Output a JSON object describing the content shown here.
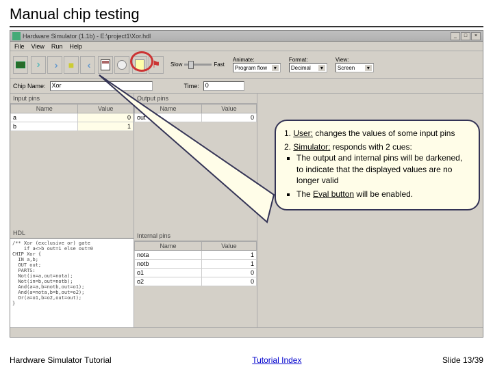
{
  "slide": {
    "title": "Manual chip testing"
  },
  "titlebar": {
    "text": "Hardware Simulator (1.1b) - E:\\project1\\Xor.hdl"
  },
  "menu": {
    "file": "File",
    "view": "View",
    "run": "Run",
    "help": "Help"
  },
  "toolbar": {
    "slow": "Slow",
    "fast": "Fast",
    "animate_lbl": "Animate:",
    "animate_val": "Program flow",
    "format_lbl": "Format:",
    "format_val": "Decimal",
    "view_lbl": "View:",
    "view_val": "Screen"
  },
  "infobar": {
    "chip_lbl": "Chip Name:",
    "chip_val": "Xor",
    "time_lbl": "Time:",
    "time_val": "0"
  },
  "panels": {
    "input_hdr": "Input pins",
    "output_hdr": "Output pins",
    "hdl_hdr": "HDL",
    "internal_hdr": "Internal pins",
    "col_name": "Name",
    "col_value": "Value"
  },
  "input_pins": [
    {
      "name": "a",
      "value": "0"
    },
    {
      "name": "b",
      "value": "1"
    }
  ],
  "output_pins": [
    {
      "name": "out",
      "value": "0"
    }
  ],
  "internal_pins": [
    {
      "name": "nota",
      "value": "1"
    },
    {
      "name": "notb",
      "value": "1"
    },
    {
      "name": "o1",
      "value": "0"
    },
    {
      "name": "o2",
      "value": "0"
    }
  ],
  "hdl": "/** Xor (exclusive or) gate\n    if a<>b out=1 else out=0\nCHIP Xor {\n  IN a,b;\n  OUT out;\n  PARTS:\n  Not(in=a,out=nota);\n  Not(in=b,out=notb);\n  And(a=a,b=notb,out=o1);\n  And(a=nota,b=b,out=o2);\n  Or(a=o1,b=o2,out=out);\n}",
  "callout": {
    "l1a": "1. ",
    "l1u": "User:",
    "l1b": " changes the values of some input pins",
    "l2a": "2. ",
    "l2u": "Simulator:",
    "l2b": " responds with 2 cues:",
    "b1": "The output and internal pins will be darkened, to indicate that the displayed values are no longer valid",
    "b2a": "The ",
    "b2u": "Eval button",
    "b2b": " will be enabled."
  },
  "footer": {
    "left": "Hardware Simulator Tutorial",
    "index": "Tutorial Index",
    "slide": "Slide 13/39"
  }
}
